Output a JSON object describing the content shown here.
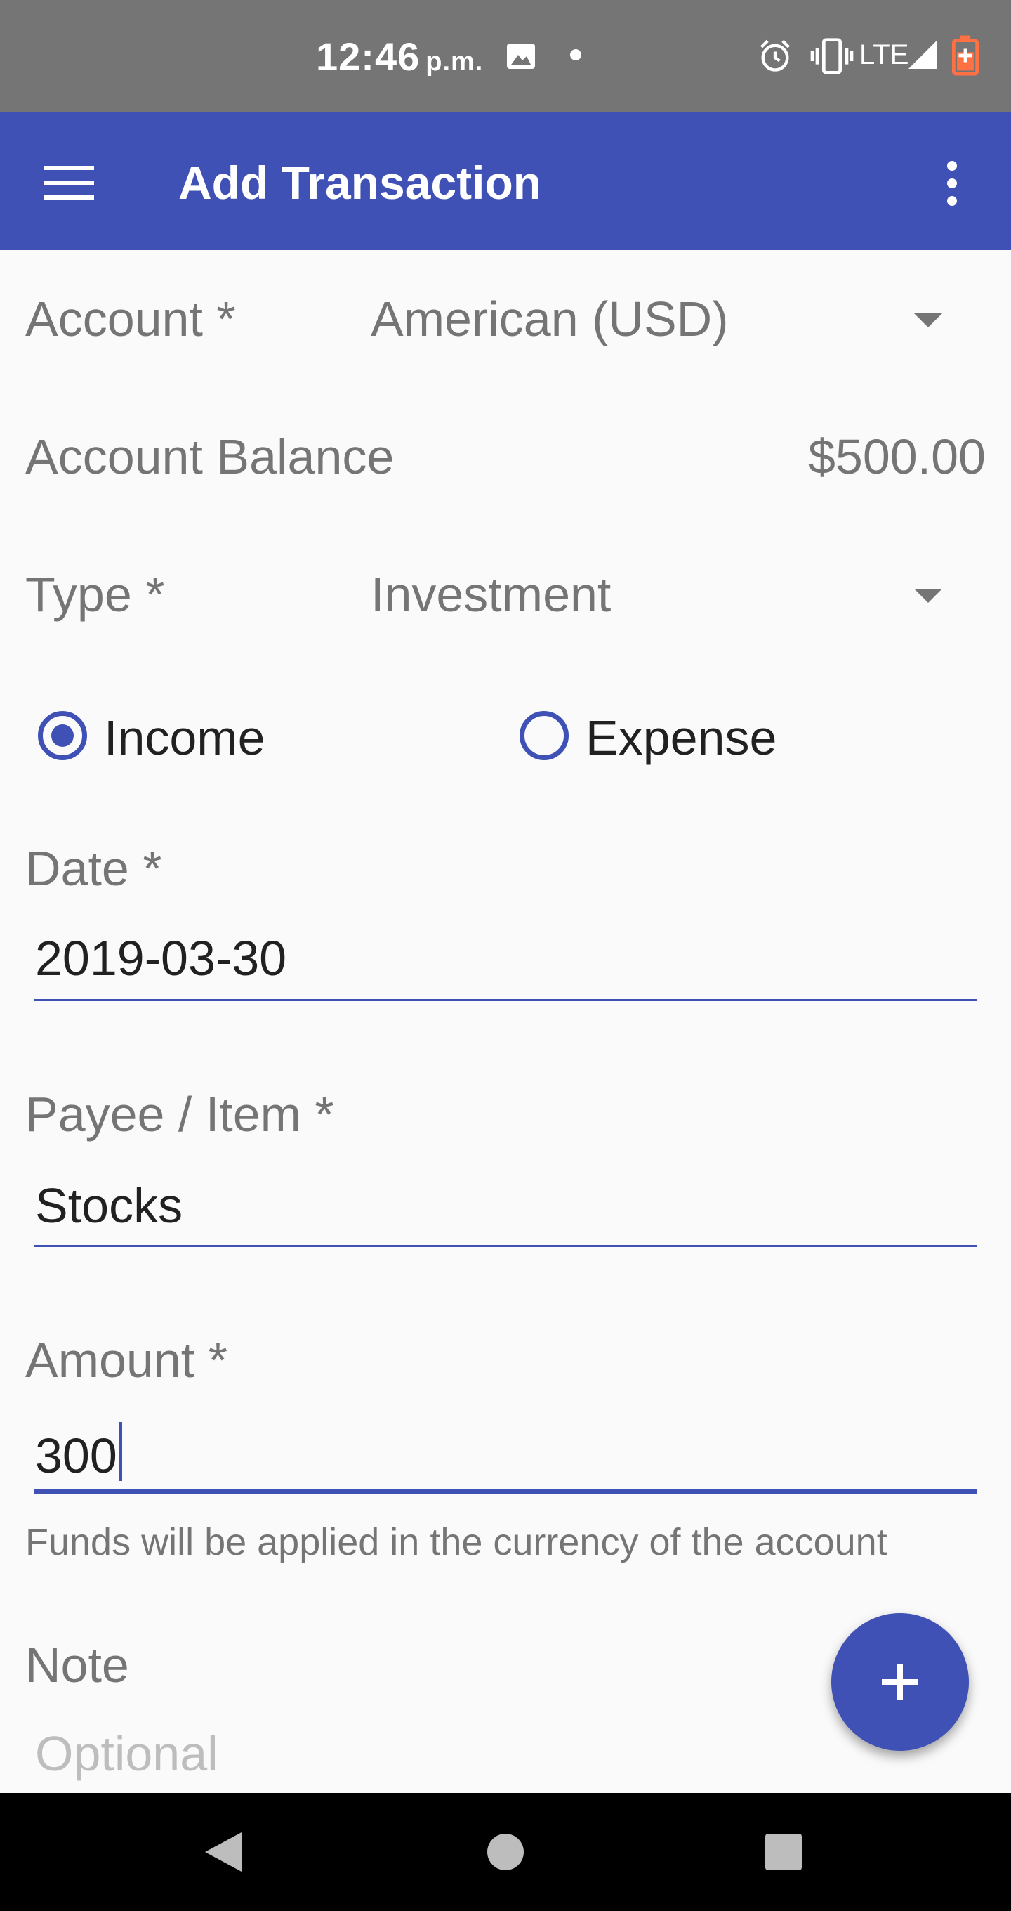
{
  "status_bar": {
    "time": "12:46",
    "ampm": "p.m.",
    "network": "LTE",
    "icons": [
      "image-icon",
      "dot-icon",
      "alarm-icon",
      "vibrate-icon",
      "signal-icon",
      "battery-charging-icon"
    ]
  },
  "app_bar": {
    "title": "Add Transaction",
    "left_icon": "menu-icon",
    "right_icon": "more-vert-icon",
    "background_color": "#3f51b5"
  },
  "form": {
    "account": {
      "label": "Account *",
      "value": "American (USD)"
    },
    "balance": {
      "label": "Account Balance",
      "value": "$500.00"
    },
    "type": {
      "label": "Type *",
      "value": "Investment"
    },
    "transaction_kind": {
      "options": [
        {
          "label": "Income",
          "selected": true
        },
        {
          "label": "Expense",
          "selected": false
        }
      ]
    },
    "date": {
      "label": "Date *",
      "value": "2019-03-30"
    },
    "payee": {
      "label": "Payee / Item *",
      "value": "Stocks"
    },
    "amount": {
      "label": "Amount *",
      "value": "300",
      "helper": "Funds will be applied in the currency of the account"
    },
    "note": {
      "label": "Note",
      "placeholder": "Optional"
    }
  },
  "fab": {
    "icon": "plus-icon"
  },
  "nav_bar": {
    "icons": [
      "back-icon",
      "home-icon",
      "recents-icon"
    ]
  }
}
